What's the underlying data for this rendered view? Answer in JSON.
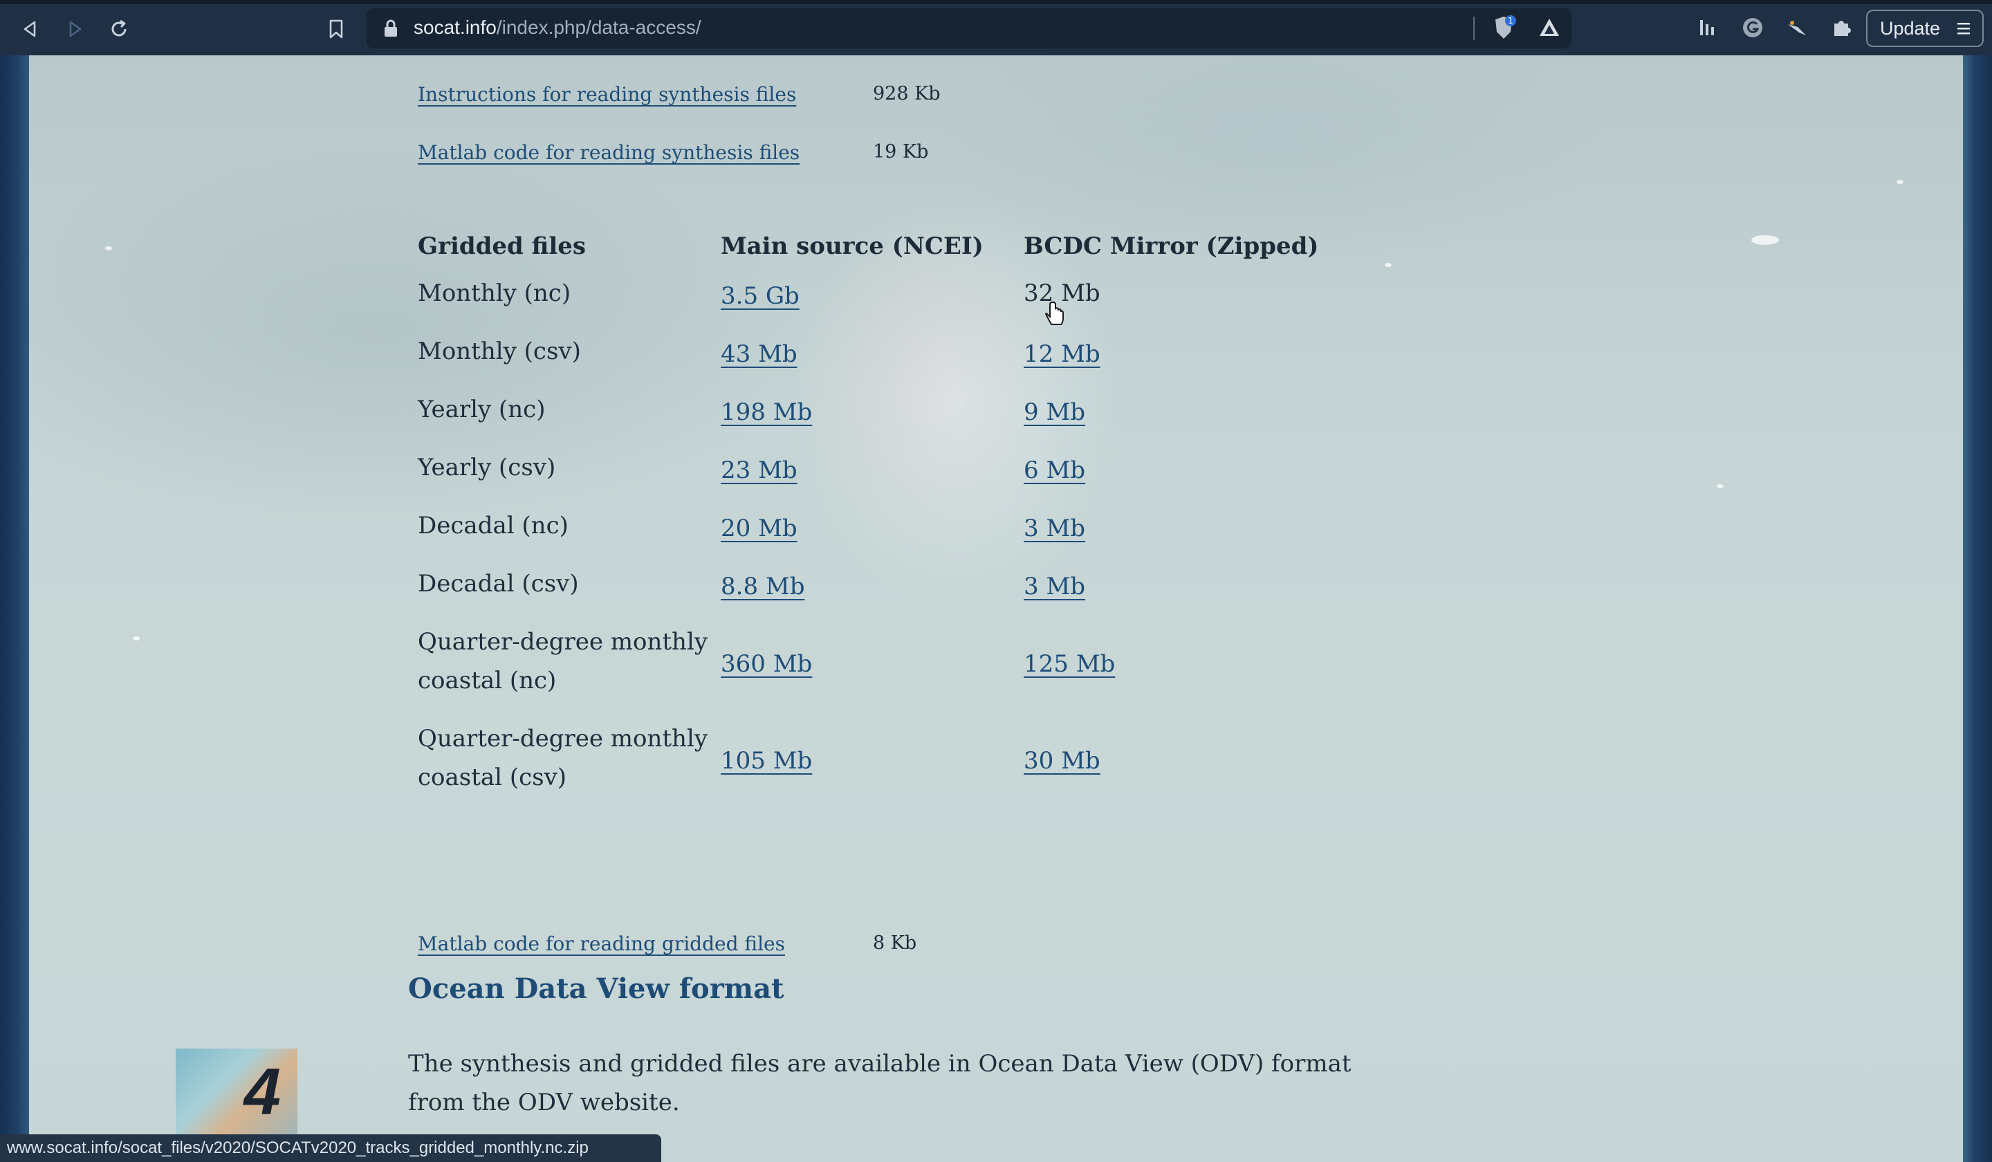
{
  "browser": {
    "url_host": "socat.info",
    "url_path": "/index.php/data-access/",
    "update_label": "Update",
    "shield_badge": "1"
  },
  "top_files": [
    {
      "label": "Instructions for reading synthesis files",
      "size": "928 Kb"
    },
    {
      "label": "Matlab code for reading synthesis files",
      "size": "19 Kb"
    }
  ],
  "gridded": {
    "headers": {
      "col1": "Gridded files",
      "col2": "Main source (NCEI)",
      "col3": "BCDC Mirror (Zipped)"
    },
    "rows": [
      {
        "name": "Monthly (nc)",
        "ncei": "3.5 Gb",
        "bcdc": "32 Mb"
      },
      {
        "name": "Monthly (csv)",
        "ncei": "43 Mb",
        "bcdc": "12 Mb"
      },
      {
        "name": "Yearly (nc)",
        "ncei": "198 Mb",
        "bcdc": "9 Mb"
      },
      {
        "name": "Yearly (csv)",
        "ncei": "23 Mb",
        "bcdc": "6 Mb"
      },
      {
        "name": "Decadal (nc)",
        "ncei": "20 Mb",
        "bcdc": "3 Mb"
      },
      {
        "name": "Decadal (csv)",
        "ncei": "8.8 Mb",
        "bcdc": "3 Mb"
      },
      {
        "name_line1": "Quarter-degree monthly",
        "name_line2": "coastal (nc)",
        "ncei": "360 Mb",
        "bcdc": "125 Mb"
      },
      {
        "name_line1": "Quarter-degree monthly",
        "name_line2": "coastal (csv)",
        "ncei": "105 Mb",
        "bcdc": "30 Mb"
      }
    ]
  },
  "matlab_gridded": {
    "label": "Matlab code for reading gridded files",
    "size": "8 Kb"
  },
  "odv": {
    "heading": "Ocean Data View format",
    "paragraph": "The synthesis and gridded files are available in Ocean Data View (ODV) format from the ODV website."
  },
  "thumbnail_number": "4",
  "status_url": "www.socat.info/socat_files/v2020/SOCATv2020_tracks_gridded_monthly.nc.zip"
}
